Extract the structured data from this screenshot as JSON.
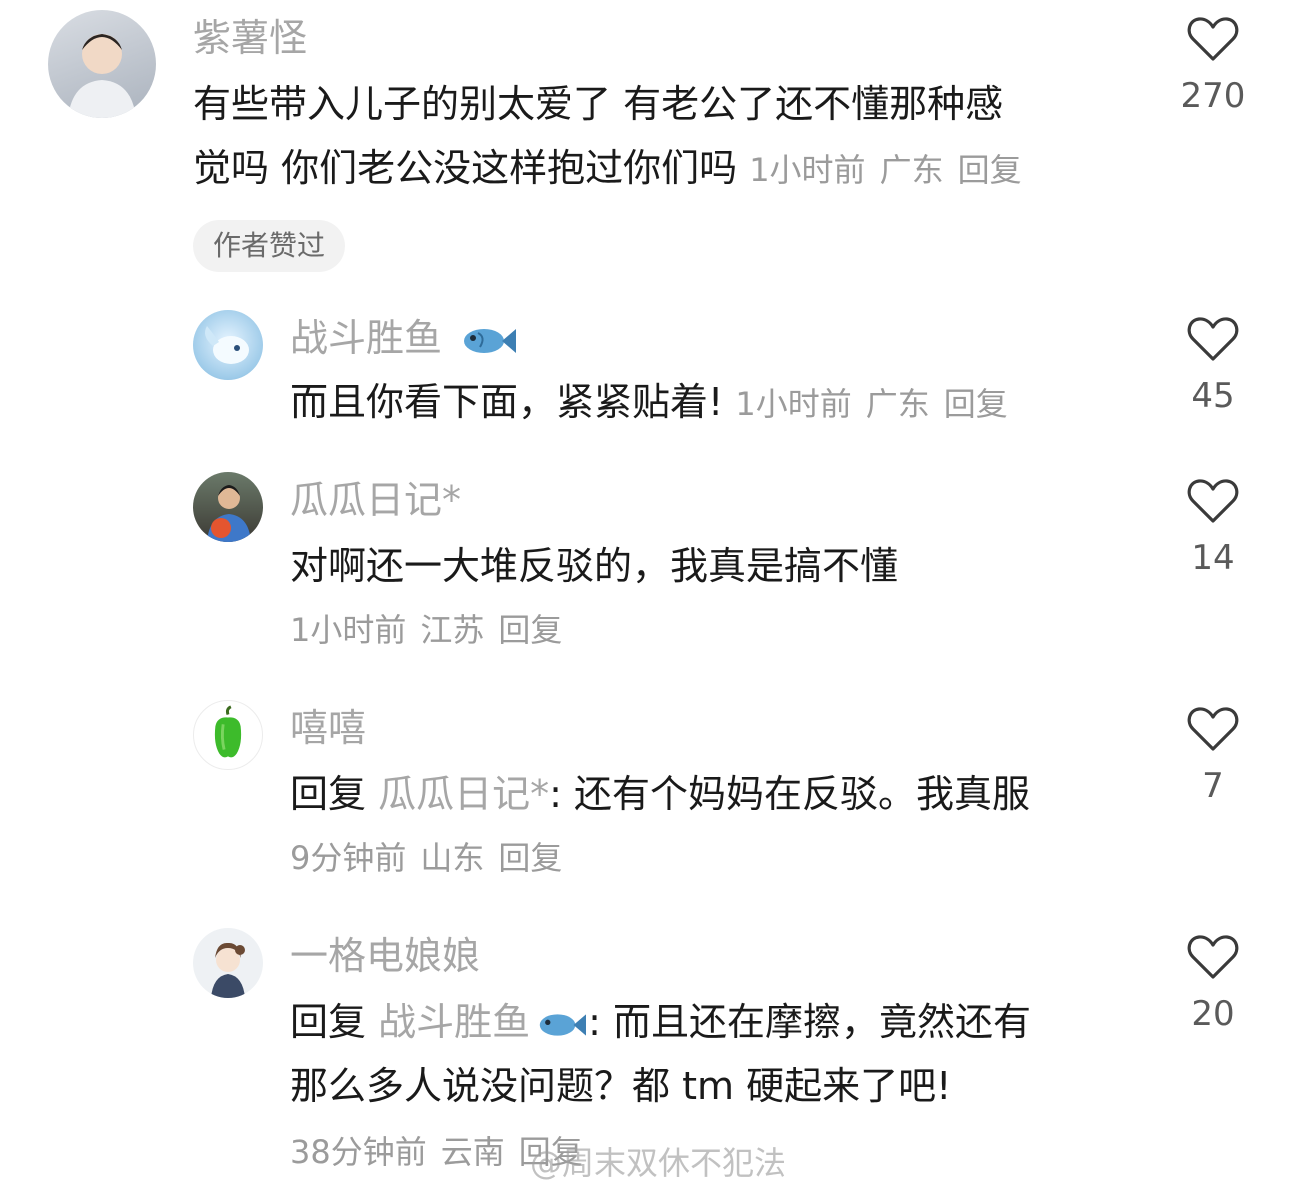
{
  "comments": [
    {
      "username": "紫薯怪",
      "text_line1": "有些带入儿子的别太爱了  有老公了还不懂那种感",
      "text_line2": "觉吗 你们老公没这样抱过你们吗",
      "time": "1小时前",
      "location": "广东",
      "reply_label": "回复",
      "like_count": "270",
      "badge": "作者赞过"
    },
    {
      "username": "战斗胜鱼",
      "text": "而且你看下面，紧紧贴着!",
      "time": "1小时前",
      "location": "广东",
      "reply_label": "回复",
      "like_count": "45"
    },
    {
      "username": "瓜瓜日记*",
      "text": "对啊还一大堆反驳的，我真是搞不懂",
      "time": "1小时前",
      "location": "江苏",
      "reply_label": "回复",
      "like_count": "14"
    },
    {
      "username": "嘻嘻",
      "reply_prefix": "回复",
      "reply_to": "瓜瓜日记*",
      "text": ": 还有个妈妈在反驳。我真服",
      "time": "9分钟前",
      "location": "山东",
      "reply_label": "回复",
      "like_count": "7"
    },
    {
      "username": "一格电娘娘",
      "reply_prefix": "回复",
      "reply_to": "战斗胜鱼",
      "text_line1": ": 而且还在摩擦，竟然还有",
      "text_line2": "那么多人说没问题？都 tm 硬起来了吧!",
      "time": "38分钟前",
      "location": "云南",
      "reply_label": "回复",
      "like_count": "20"
    }
  ],
  "watermark": "@周末双休不犯法",
  "colors": {
    "username": "#a6a6a6",
    "body_text": "#1a1a1a",
    "meta": "#9b9b9b",
    "badge_bg": "#f2f2f2",
    "heart_stroke": "#3a3a3a"
  }
}
